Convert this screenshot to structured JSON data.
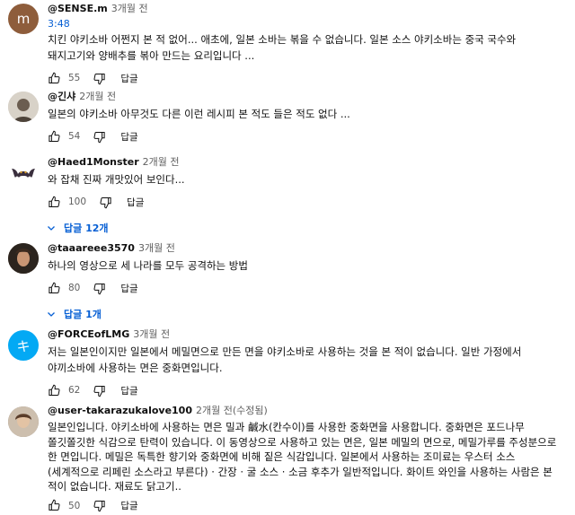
{
  "comments": [
    {
      "avatar_letter": "m",
      "avatar_color": "#8e5d3b",
      "handle": "@SENSE.m",
      "time": "3개월 전",
      "timestamp": "3:48",
      "text": "치킨 야키소바 어쩐지 본 적 없어... 애초에, 일본 소바는 볶을 수 없습니다. 일본 소스 야키소바는 중국 국수와 돼지고기와 양배추를 볶아 만드는 요리입니다 ...",
      "likes": "55",
      "reply_label": "답글"
    },
    {
      "avatar_letter": "",
      "avatar_color": "#c9c2b8",
      "handle": "@긴샤",
      "time": "2개월 전",
      "text": "일본의 야키소바 아무것도 다른 이런 레시피 본 적도 들은 적도 없다 ...",
      "likes": "54",
      "reply_label": "답글"
    },
    {
      "avatar_letter": "",
      "avatar_color": "#ffffff",
      "handle": "@Haed1Monster",
      "time": "2개월 전",
      "text": "와 잡채 진짜 개맛있어 보인다...",
      "likes": "100",
      "reply_label": "답글",
      "replies_label": "답글 12개"
    },
    {
      "avatar_letter": "",
      "avatar_color": "#5a4636",
      "handle": "@taaareee3570",
      "time": "3개월 전",
      "text": "하나의 영상으로 세 나라를 모두 공격하는 방법",
      "likes": "80",
      "reply_label": "답글",
      "replies_label": "답글 1개"
    },
    {
      "avatar_letter": "キ",
      "avatar_color": "#03a9f4",
      "handle": "@FORCEofLMG",
      "time": "3개월 전",
      "text": "저는 일본인이지만 일본에서 메밀면으로 만든 면을 야키소바로 사용하는 것을 본 적이 없습니다. 일반 가정에서 야끼소바에 사용하는 면은 중화면입니다.",
      "likes": "62",
      "reply_label": "답글"
    },
    {
      "avatar_letter": "",
      "avatar_color": "#8a7a6c",
      "handle": "@user-takarazukalove100",
      "time": "2개월 전(수정됨)",
      "text": "일본인입니다. 야키소바에 사용하는 면은 밀과 鹹水(칸수이)를 사용한 중화면을 사용합니다. 중화면은 포드나무 쫄깃쫄깃한 식감으로 탄력이 있습니다. 이 동영상으로 사용하고 있는 면은, 일본 메밀의 면으로, 메밀가루를 주성분으로 한 면입니다. 메밀은 독특한 향기와 중화면에 비해 짙은 식감입니다. 일본에서 사용하는 조미료는 우스터 소스 (세계적으로 리페린 소스라고 부른다) · 간장 · 굴 소스 · 소금 후추가 일반적입니다. 화이트 와인을 사용하는 사람은 본 적이 없습니다. 재료도 닭고기..",
      "likes": "50",
      "reply_label": "답글"
    }
  ]
}
